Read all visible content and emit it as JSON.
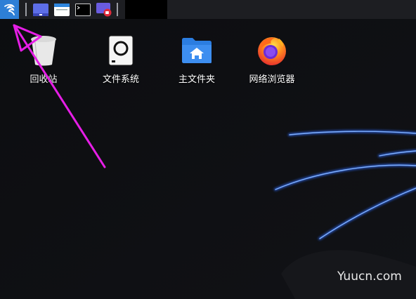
{
  "taskbar": {
    "menu_icon": "kali-dragon-icon",
    "apps": [
      {
        "name": "show-desktop",
        "icon": "desktop-icon"
      },
      {
        "name": "file-manager",
        "icon": "folder-window-icon"
      },
      {
        "name": "terminal",
        "icon": "terminal-icon"
      },
      {
        "name": "screen-recorder",
        "icon": "screen-record-icon"
      }
    ]
  },
  "desktop": {
    "icons": [
      {
        "label": "回收站",
        "icon": "trash-icon"
      },
      {
        "label": "文件系统",
        "icon": "filesystem-icon"
      },
      {
        "label": "主文件夹",
        "icon": "home-folder-icon"
      },
      {
        "label": "网络浏览器",
        "icon": "firefox-icon"
      }
    ]
  },
  "watermark": "Yuucn.com",
  "colors": {
    "taskbar_bg": "#1d1e22",
    "menu_button_bg": "#2d7fd6",
    "desktop_bg": "#0b0c0f",
    "accent_blue": "#3a7bff",
    "annotation_arrow": "#e61ee6"
  }
}
